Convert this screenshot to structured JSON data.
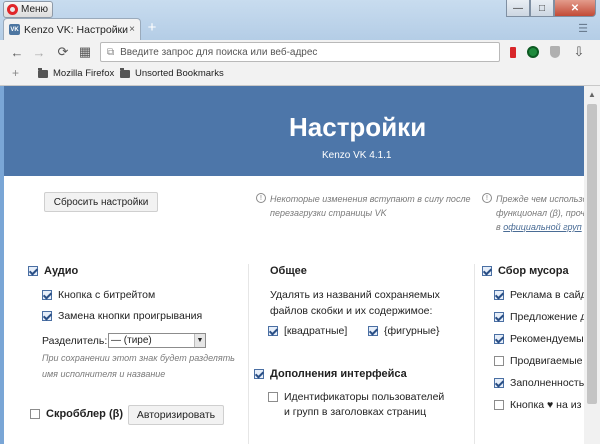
{
  "window": {
    "menu_label": "Меню",
    "minimize": "—",
    "maximize": "□",
    "close": "✕"
  },
  "tabs": [
    {
      "label": "Kenzo VK: Настройки",
      "close": "×",
      "favicon": "vk"
    }
  ],
  "new_tab": "+",
  "toolbar": {
    "back": "←",
    "forward": "→",
    "reload": "⟳",
    "speed_dial": "▦",
    "url_placeholder": "Введите запрос для поиска или веб-адрес"
  },
  "bookmarks": {
    "add": "+",
    "items": [
      {
        "label": "Mozilla Firefox"
      },
      {
        "label": "Unsorted Bookmarks"
      }
    ]
  },
  "banner": {
    "title": "Настройки",
    "version": "Kenzo VK 4.1.1"
  },
  "reset_button": "Сбросить настройки",
  "notes": {
    "restart": {
      "line1": "Некоторые изменения вступают в силу после",
      "line2": "перезагрузки страницы VK"
    },
    "right": {
      "line1": "Прежде чем использо",
      "line2": "функционал (β), проч",
      "line3_prefix": "в",
      "line3_link": "официальной груп"
    }
  },
  "audio": {
    "title": "Аудио",
    "options": [
      {
        "label": "Кнопка с битрейтом",
        "checked": true
      },
      {
        "label": "Замена кнопки проигрывания",
        "checked": true
      }
    ],
    "separator_label": "Разделитель:",
    "separator_value": "— (тире)",
    "separator_hint_1": "При сохранении этот знак будет разделять",
    "separator_hint_2": "имя исполнителя и название"
  },
  "scrobbler": {
    "title": "Скробблер (β)",
    "checked": false,
    "auth_button": "Авторизировать"
  },
  "general": {
    "title": "Общее",
    "desc_1": "Удалять из названий сохраняемых",
    "desc_2": "файлов скобки и их содержимое:",
    "options": [
      {
        "label": "[квадратные]",
        "checked": true
      },
      {
        "label": "{фигурные}",
        "checked": true
      }
    ]
  },
  "addons": {
    "title": "Дополнения интерфейса",
    "checked": true,
    "options": [
      {
        "label_1": "Идентификаторы пользователей",
        "label_2": "и групп в заголовках страниц",
        "checked": false
      }
    ]
  },
  "garbage": {
    "title": "Сбор мусора",
    "checked": true,
    "options": [
      {
        "label": "Реклама в сайд",
        "checked": true
      },
      {
        "label": "Предложение д",
        "checked": true
      },
      {
        "label": "Рекомендуемые",
        "checked": true
      },
      {
        "label": "Продвигаемые",
        "checked": false
      },
      {
        "label": "Заполненность",
        "checked": true
      },
      {
        "label": "Кнопка ♥ на из",
        "checked": false
      }
    ]
  },
  "colors": {
    "banner": "#4d76a9",
    "titlebar": "#b4cde6",
    "close_button": "#c24a36"
  }
}
